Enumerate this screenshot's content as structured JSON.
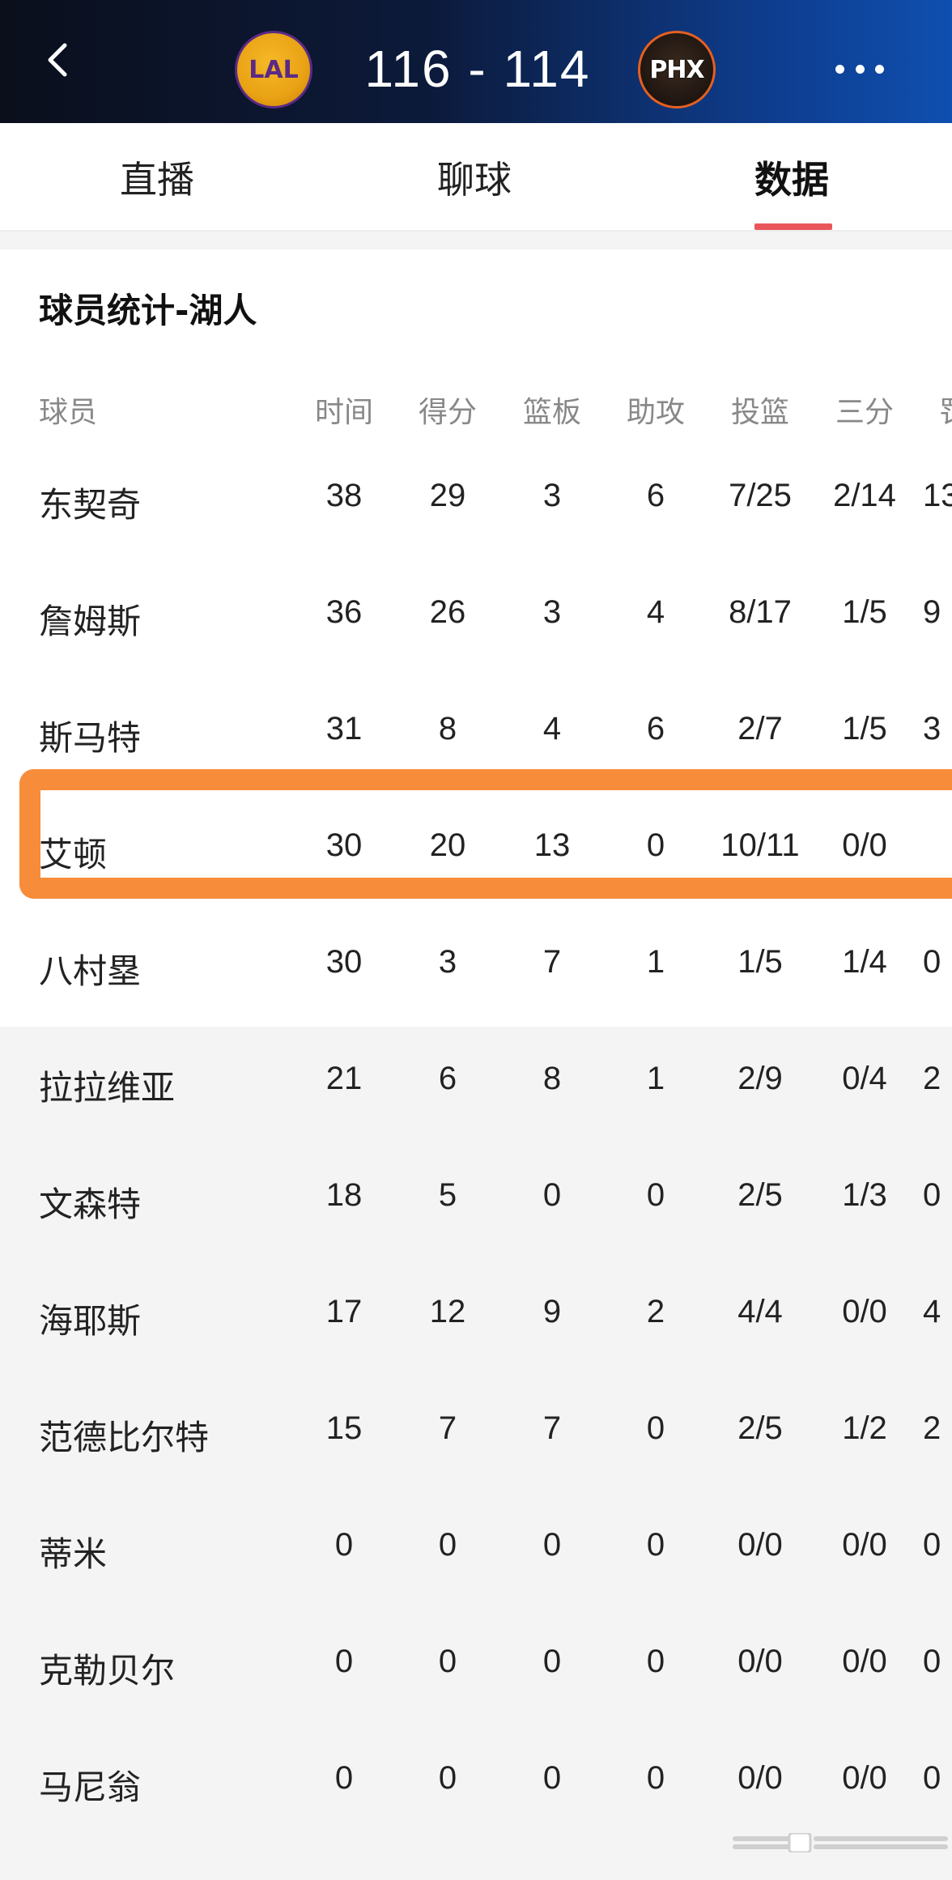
{
  "header": {
    "home_team_logo": "LAL",
    "away_team_logo": "PHX",
    "score_text": "116 - 114",
    "back_icon": "chevron-left-icon",
    "more_icon": "more-dots-icon"
  },
  "tabs": [
    {
      "label": "直播",
      "active": false
    },
    {
      "label": "聊球",
      "active": false
    },
    {
      "label": "数据",
      "active": true
    }
  ],
  "section_title": "球员统计-湖人",
  "columns": [
    "球员",
    "时间",
    "得分",
    "篮板",
    "助攻",
    "投篮",
    "三分",
    "罚"
  ],
  "rows": [
    {
      "name": "东契奇",
      "min": "38",
      "pts": "29",
      "reb": "3",
      "ast": "6",
      "fg": "7/25",
      "three": "2/14",
      "ft": "13"
    },
    {
      "name": "詹姆斯",
      "min": "36",
      "pts": "26",
      "reb": "3",
      "ast": "4",
      "fg": "8/17",
      "three": "1/5",
      "ft": "9"
    },
    {
      "name": "斯马特",
      "min": "31",
      "pts": "8",
      "reb": "4",
      "ast": "6",
      "fg": "2/7",
      "three": "1/5",
      "ft": "3"
    },
    {
      "name": "艾顿",
      "min": "30",
      "pts": "20",
      "reb": "13",
      "ast": "0",
      "fg": "10/11",
      "three": "0/0",
      "ft": ""
    },
    {
      "name": "八村塁",
      "min": "30",
      "pts": "3",
      "reb": "7",
      "ast": "1",
      "fg": "1/5",
      "three": "1/4",
      "ft": "0"
    },
    {
      "name": "拉拉维亚",
      "min": "21",
      "pts": "6",
      "reb": "8",
      "ast": "1",
      "fg": "2/9",
      "three": "0/4",
      "ft": "2"
    },
    {
      "name": "文森特",
      "min": "18",
      "pts": "5",
      "reb": "0",
      "ast": "0",
      "fg": "2/5",
      "three": "1/3",
      "ft": "0"
    },
    {
      "name": "海耶斯",
      "min": "17",
      "pts": "12",
      "reb": "9",
      "ast": "2",
      "fg": "4/4",
      "three": "0/0",
      "ft": "4"
    },
    {
      "name": "范德比尔特",
      "min": "15",
      "pts": "7",
      "reb": "7",
      "ast": "0",
      "fg": "2/5",
      "three": "1/2",
      "ft": "2"
    },
    {
      "name": "蒂米",
      "min": "0",
      "pts": "0",
      "reb": "0",
      "ast": "0",
      "fg": "0/0",
      "three": "0/0",
      "ft": "0"
    },
    {
      "name": "克勒贝尔",
      "min": "0",
      "pts": "0",
      "reb": "0",
      "ast": "0",
      "fg": "0/0",
      "three": "0/0",
      "ft": "0"
    },
    {
      "name": "马尼翁",
      "min": "0",
      "pts": "0",
      "reb": "0",
      "ast": "0",
      "fg": "0/0",
      "three": "0/0",
      "ft": "0"
    }
  ],
  "colors": {
    "highlight": "#f78c3b",
    "tab_underline": "#e8565a"
  }
}
